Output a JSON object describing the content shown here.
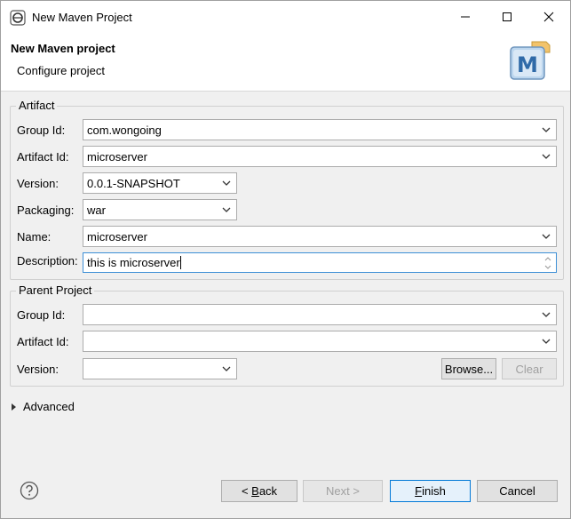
{
  "window": {
    "title": "New Maven Project",
    "controls": {
      "minimize": "—",
      "maximize": "☐",
      "close": "✕"
    }
  },
  "banner": {
    "title": "New Maven project",
    "subtitle": "Configure project",
    "logo_letter": "M"
  },
  "artifact": {
    "legend": "Artifact",
    "group_id_label": "Group Id:",
    "group_id_value": "com.wongoing",
    "artifact_id_label": "Artifact Id:",
    "artifact_id_value": "microserver",
    "version_label": "Version:",
    "version_value": "0.0.1-SNAPSHOT",
    "packaging_label": "Packaging:",
    "packaging_value": "war",
    "name_label": "Name:",
    "name_value": "microserver",
    "description_label": "Description:",
    "description_value": "this is microserver"
  },
  "parent": {
    "legend": "Parent Project",
    "group_id_label": "Group Id:",
    "group_id_value": "",
    "artifact_id_label": "Artifact Id:",
    "artifact_id_value": "",
    "version_label": "Version:",
    "version_value": "",
    "browse_label": "Browse...",
    "clear_label": "Clear"
  },
  "advanced": {
    "label": "Advanced"
  },
  "footer": {
    "back_prefix": "< ",
    "back_mnemonic": "B",
    "back_rest": "ack",
    "next_label": "Next >",
    "finish_mnemonic": "F",
    "finish_rest": "inish",
    "cancel_label": "Cancel"
  },
  "colors": {
    "accent_focus": "#3d8fd6",
    "default_button_border": "#0078d7"
  }
}
